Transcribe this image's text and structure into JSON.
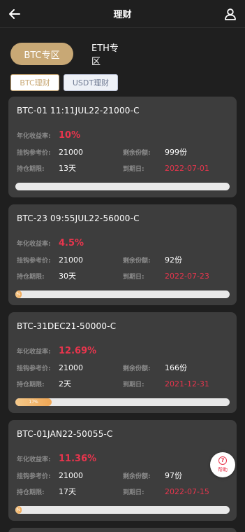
{
  "header": {
    "title": "理财",
    "back_icon": "arrow-left-icon",
    "user_icon": "user-icon"
  },
  "zones": [
    {
      "label": "BTC专区",
      "active": true
    },
    {
      "label": "ETH专区",
      "active": false
    }
  ],
  "subtabs": [
    {
      "label": "BTC理财",
      "active": true
    },
    {
      "label": "USDT理财",
      "active": false
    }
  ],
  "labels": {
    "rate": "年化收益率:",
    "ref_price": "挂钩参考价:",
    "remaining": "剩余份额:",
    "period": "持仓期限:",
    "expiry": "到期日:"
  },
  "cards": [
    {
      "title": "BTC-01 11:11JUL22-21000-C",
      "rate": "10%",
      "ref_price": "21000",
      "remaining": "999份",
      "period": "13天",
      "expiry": "2022-07-01",
      "progress": 0,
      "progress_label": ""
    },
    {
      "title": "BTC-23 09:55JUL22-56000-C",
      "rate": "4.5%",
      "ref_price": "21000",
      "remaining": "92份",
      "period": "30天",
      "expiry": "2022-07-23",
      "progress": 0.02,
      "progress_label": "%"
    },
    {
      "title": "BTC-31DEC21-50000-C",
      "rate": "12.69%",
      "ref_price": "21000",
      "remaining": "166份",
      "period": "2天",
      "expiry": "2021-12-31",
      "progress": 0.17,
      "progress_label": "17%"
    },
    {
      "title": "BTC-01JAN22-50055-C",
      "rate": "11.36%",
      "ref_price": "21000",
      "remaining": "97份",
      "period": "17天",
      "expiry": "2022-07-15",
      "progress": 0.02,
      "progress_label": "%"
    }
  ],
  "help": {
    "label": "帮助",
    "icon": "question-icon"
  },
  "colors": {
    "accent": "#c8a875",
    "rate": "#e8354d",
    "card": "#3d3d3d",
    "background": "#1f1f1f"
  }
}
